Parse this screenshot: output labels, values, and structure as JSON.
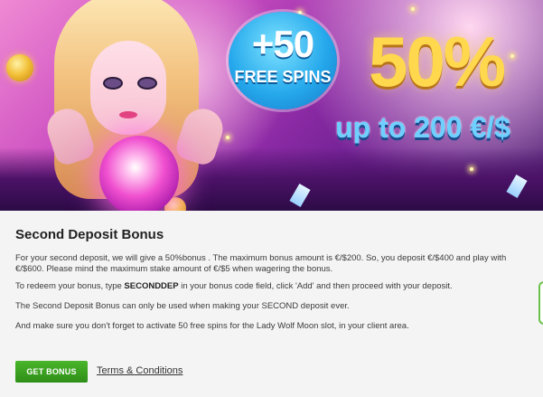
{
  "banner": {
    "spins_plus": "+50",
    "spins_label": "FREE SPINS",
    "percent": "50%",
    "upto": "up to 200 €/$"
  },
  "content": {
    "title": "Second Deposit Bonus",
    "p1": "For your second deposit, we will give a 50%bonus . The maximum bonus amount is €/$200. So, you deposit €/$400 and play with €/$600. Please mind the maximum stake amount of €/$5 when wagering the bonus.",
    "p2_before": "To redeem your bonus, type ",
    "p2_code": "SECONDDEP",
    "p2_after": " in your bonus code field, click 'Add' and then proceed with your deposit.",
    "p3": "The Second Deposit Bonus can only be used when making your SECOND deposit ever.",
    "p4": "And make sure you don't forget to activate 50 free spins for the Lady Wolf Moon slot, in your client area.",
    "button_label": "GET BONUS",
    "link_label": "Terms & Conditions"
  },
  "colors": {
    "button_green": "#3aa321",
    "background": "#f4f4f4",
    "banner_purple": "#8a2aa4",
    "badge_blue": "#26a9ec",
    "gold": "#ffd84d"
  }
}
